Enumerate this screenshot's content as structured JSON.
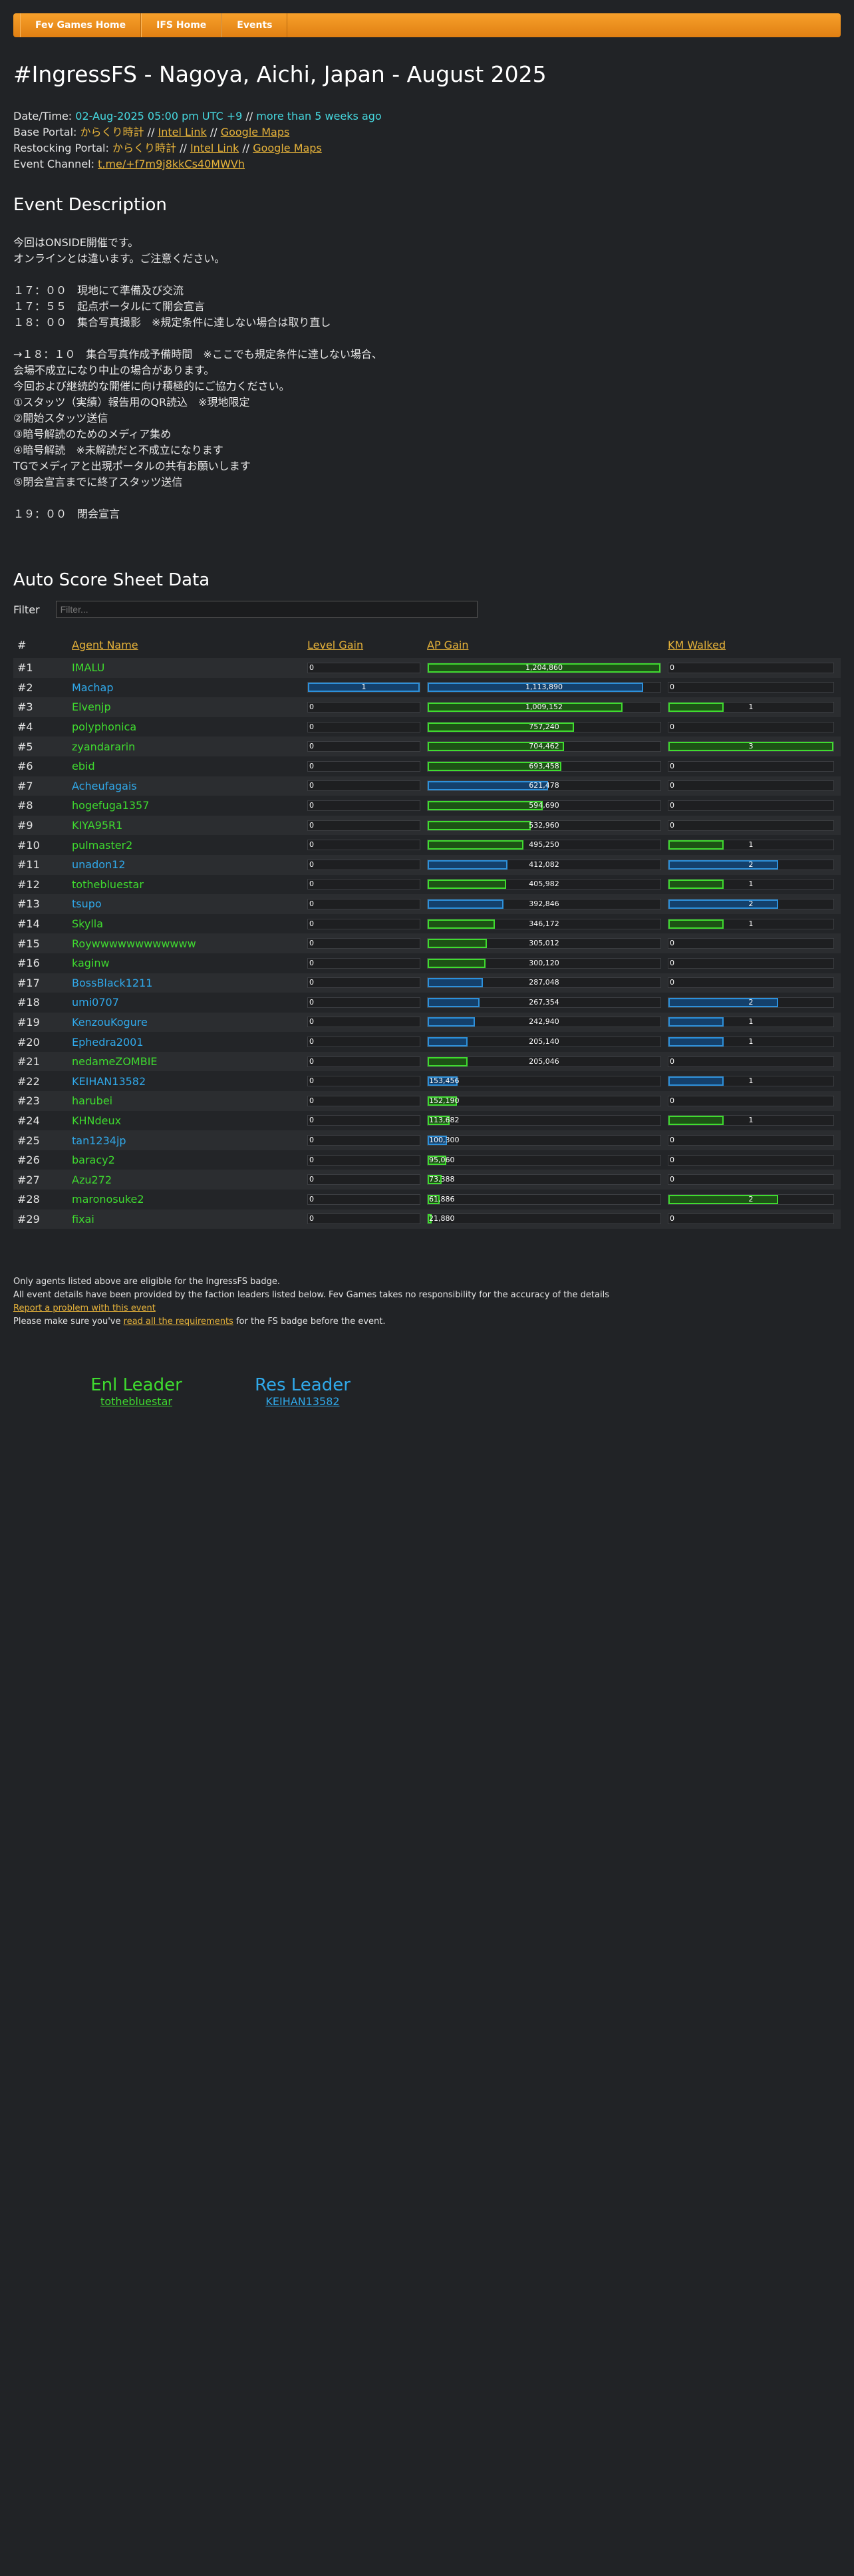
{
  "nav": [
    "Fev Games Home",
    "IFS Home",
    "Events"
  ],
  "title": "#IngressFS - Nagoya, Aichi, Japan - August 2025",
  "info": {
    "datetime_label": "Date/Time:",
    "datetime_value": "02-Aug-2025 05:00 pm UTC +9",
    "datetime_sep": " // ",
    "datetime_ago": "more than 5 weeks ago",
    "base_label": "Base Portal:",
    "base_name": "からくり時計",
    "restock_label": "Restocking Portal:",
    "restock_name": "からくり時計",
    "intel": "Intel Link",
    "maps": "Google Maps",
    "sep": " // ",
    "channel_label": "Event Channel:",
    "channel_link": "t.me/+f7m9j8kkCs40MWVh"
  },
  "description_heading": "Event Description",
  "description": "今回はONSIDE開催です。\nオンラインとは違います。ご注意ください。\n\n１７：００　現地にて準備及び交流\n１７：５５　起点ポータルにて開会宣言\n１８：００　集合写真撮影　※規定条件に達しない場合は取り直し\n\n→１８：１０　集合写真作成予備時間　※ここでも規定条件に達しない場合、\n会場不成立になり中止の場合があります。\n今回および継続的な開催に向け積極的にご協力ください。\n①スタッツ（実績）報告用のQR読込　※現地限定\n②開始スタッツ送信\n③暗号解読のためのメディア集め\n④暗号解読　※未解読だと不成立になります\nTGでメディアと出現ポータルの共有お願いします\n⑤閉会宣言までに終了スタッツ送信\n\n１９：００　閉会宣言",
  "score_heading": "Auto Score Sheet Data",
  "filter_label": "Filter",
  "filter_placeholder": "Filter...",
  "columns": [
    "#",
    "Agent Name",
    "Level Gain",
    "AP Gain",
    "KM Walked"
  ],
  "colors": {
    "enl": "#3fdb2f",
    "res": "#30a9ea",
    "accent": "#e8b43a"
  },
  "ap_max": 1204860,
  "km_max": 3,
  "level_max": 1,
  "rows": [
    {
      "rank": "#1",
      "name": "IMALU",
      "faction": "enl",
      "level": 0,
      "ap": 1204860,
      "ap_label": "1,204,860",
      "km": 0
    },
    {
      "rank": "#2",
      "name": "Machap",
      "faction": "res",
      "level": 1,
      "ap": 1113890,
      "ap_label": "1,113,890",
      "km": 0
    },
    {
      "rank": "#3",
      "name": "Elvenjp",
      "faction": "enl",
      "level": 0,
      "ap": 1009152,
      "ap_label": "1,009,152",
      "km": 1
    },
    {
      "rank": "#4",
      "name": "polyphonica",
      "faction": "enl",
      "level": 0,
      "ap": 757240,
      "ap_label": "757,240",
      "km": 0
    },
    {
      "rank": "#5",
      "name": "zyandararin",
      "faction": "enl",
      "level": 0,
      "ap": 704462,
      "ap_label": "704,462",
      "km": 3
    },
    {
      "rank": "#6",
      "name": "ebid",
      "faction": "enl",
      "level": 0,
      "ap": 693458,
      "ap_label": "693,458",
      "km": 0
    },
    {
      "rank": "#7",
      "name": "Acheufagais",
      "faction": "res",
      "level": 0,
      "ap": 621478,
      "ap_label": "621,478",
      "km": 0
    },
    {
      "rank": "#8",
      "name": "hogefuga1357",
      "faction": "enl",
      "level": 0,
      "ap": 594690,
      "ap_label": "594,690",
      "km": 0
    },
    {
      "rank": "#9",
      "name": "KIYA95R1",
      "faction": "enl",
      "level": 0,
      "ap": 532960,
      "ap_label": "532,960",
      "km": 0
    },
    {
      "rank": "#10",
      "name": "pulmaster2",
      "faction": "enl",
      "level": 0,
      "ap": 495250,
      "ap_label": "495,250",
      "km": 1
    },
    {
      "rank": "#11",
      "name": "unadon12",
      "faction": "res",
      "level": 0,
      "ap": 412082,
      "ap_label": "412,082",
      "km": 2
    },
    {
      "rank": "#12",
      "name": "tothebluestar",
      "faction": "enl",
      "level": 0,
      "ap": 405982,
      "ap_label": "405,982",
      "km": 1
    },
    {
      "rank": "#13",
      "name": "tsupo",
      "faction": "res",
      "level": 0,
      "ap": 392846,
      "ap_label": "392,846",
      "km": 2
    },
    {
      "rank": "#14",
      "name": "Skylla",
      "faction": "enl",
      "level": 0,
      "ap": 346172,
      "ap_label": "346,172",
      "km": 1
    },
    {
      "rank": "#15",
      "name": "Roywwwwwwwwwwww",
      "faction": "enl",
      "level": 0,
      "ap": 305012,
      "ap_label": "305,012",
      "km": 0
    },
    {
      "rank": "#16",
      "name": "kaginw",
      "faction": "enl",
      "level": 0,
      "ap": 300120,
      "ap_label": "300,120",
      "km": 0
    },
    {
      "rank": "#17",
      "name": "BossBlack1211",
      "faction": "res",
      "level": 0,
      "ap": 287048,
      "ap_label": "287,048",
      "km": 0
    },
    {
      "rank": "#18",
      "name": "umi0707",
      "faction": "res",
      "level": 0,
      "ap": 267354,
      "ap_label": "267,354",
      "km": 2
    },
    {
      "rank": "#19",
      "name": "KenzouKogure",
      "faction": "res",
      "level": 0,
      "ap": 242940,
      "ap_label": "242,940",
      "km": 1
    },
    {
      "rank": "#20",
      "name": "Ephedra2001",
      "faction": "res",
      "level": 0,
      "ap": 205140,
      "ap_label": "205,140",
      "km": 1
    },
    {
      "rank": "#21",
      "name": "nedameZOMBIE",
      "faction": "enl",
      "level": 0,
      "ap": 205046,
      "ap_label": "205,046",
      "km": 0
    },
    {
      "rank": "#22",
      "name": "KEIHAN13582",
      "faction": "res",
      "level": 0,
      "ap": 153456,
      "ap_label": "153,456",
      "km": 1
    },
    {
      "rank": "#23",
      "name": "harubei",
      "faction": "enl",
      "level": 0,
      "ap": 152190,
      "ap_label": "152,190",
      "km": 0
    },
    {
      "rank": "#24",
      "name": "KHNdeux",
      "faction": "enl",
      "level": 0,
      "ap": 113682,
      "ap_label": "113,682",
      "km": 1
    },
    {
      "rank": "#25",
      "name": "tan1234jp",
      "faction": "res",
      "level": 0,
      "ap": 100300,
      "ap_label": "100,300",
      "km": 0
    },
    {
      "rank": "#26",
      "name": "baracy2",
      "faction": "enl",
      "level": 0,
      "ap": 95060,
      "ap_label": "95,060",
      "km": 0
    },
    {
      "rank": "#27",
      "name": "Azu272",
      "faction": "enl",
      "level": 0,
      "ap": 73388,
      "ap_label": "73,388",
      "km": 0
    },
    {
      "rank": "#28",
      "name": "maronosuke2",
      "faction": "enl",
      "level": 0,
      "ap": 61886,
      "ap_label": "61,886",
      "km": 2
    },
    {
      "rank": "#29",
      "name": "fixai",
      "faction": "enl",
      "level": 0,
      "ap": 21880,
      "ap_label": "21,880",
      "km": 0
    }
  ],
  "footer": {
    "line1": "Only agents listed above are eligible for the IngressFS badge.",
    "line2": "All event details have been provided by the faction leaders listed below. Fev Games takes no responsibility for the accuracy of the details",
    "report_link": "Report a problem with this event",
    "line3_pre": "Please make sure you've ",
    "line3_link": "read all the requirements",
    "line3_post": " for the FS badge before the event."
  },
  "leaders": {
    "enl_title": "Enl Leader",
    "enl_name": "tothebluestar",
    "res_title": "Res Leader",
    "res_name": "KEIHAN13582"
  }
}
